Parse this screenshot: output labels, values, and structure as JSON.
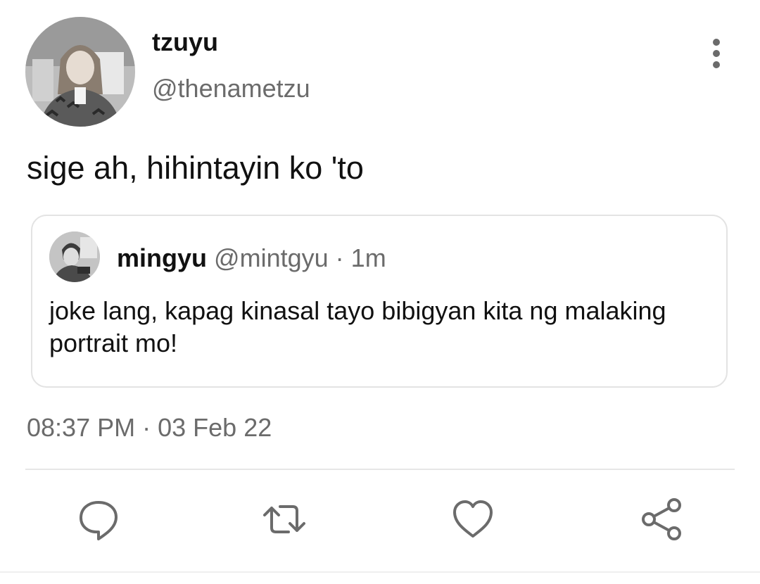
{
  "tweet": {
    "author": {
      "display_name": "tzuyu",
      "handle": "@thenametzu"
    },
    "text": "sige ah, hihintayin ko 'to",
    "timestamp": "08:37 PM",
    "date": "03 Feb 22",
    "separator": "·"
  },
  "quoted_tweet": {
    "author": {
      "display_name": "mingyu",
      "handle": "@mintgyu"
    },
    "separator": "·",
    "time": "1m",
    "text": "joke lang, kapag kinasal tayo bibigyan kita ng malaking portrait mo!"
  },
  "actions": {
    "reply_icon": "reply-icon",
    "retweet_icon": "retweet-icon",
    "like_icon": "heart-icon",
    "share_icon": "share-icon"
  },
  "menu": {
    "more_icon": "more-vertical-icon"
  },
  "colors": {
    "text_primary": "#111111",
    "text_secondary": "#6b6b6b",
    "border": "#e3e3e3",
    "icon": "#6b6b6b"
  }
}
